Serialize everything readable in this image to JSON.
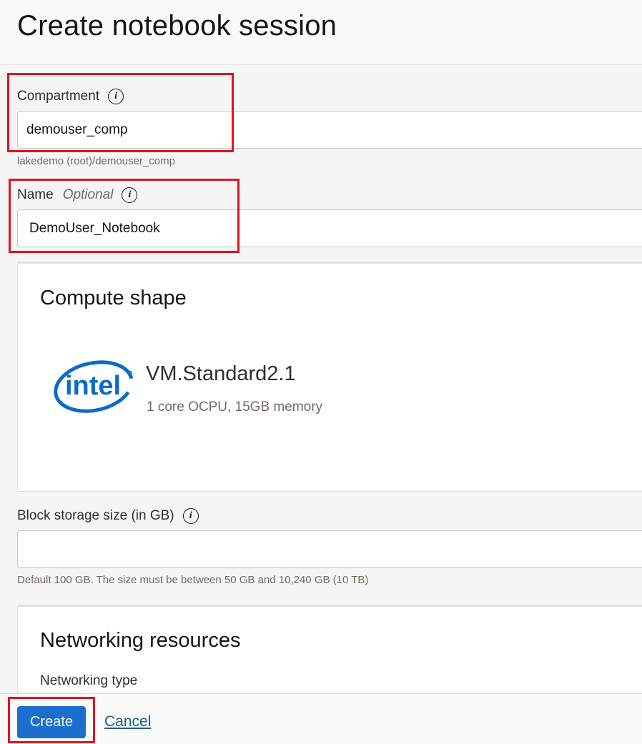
{
  "header": {
    "title": "Create notebook session"
  },
  "compartment": {
    "label": "Compartment",
    "value": "demouser_comp",
    "hint": "lakedemo (root)/demouser_comp"
  },
  "name": {
    "label": "Name",
    "optional": "Optional",
    "value": "DemoUser_Notebook"
  },
  "info_icon_glyph": "i",
  "compute_shape": {
    "title": "Compute shape",
    "shape_name": "VM.Standard2.1",
    "shape_desc": "1 core OCPU, 15GB memory",
    "logo_text": "intel"
  },
  "block_storage": {
    "label": "Block storage size (in GB)",
    "value": "",
    "hint": "Default 100 GB. The size must be between 50 GB and 10,240 GB (10 TB)"
  },
  "networking": {
    "title": "Networking resources",
    "type_label": "Networking type"
  },
  "footer": {
    "create_label": "Create",
    "cancel_label": "Cancel"
  },
  "colors": {
    "primary": "#1b6fcf",
    "highlight": "#e0141e",
    "intel_blue": "#0a6bc8",
    "link": "#1b5f8f"
  }
}
